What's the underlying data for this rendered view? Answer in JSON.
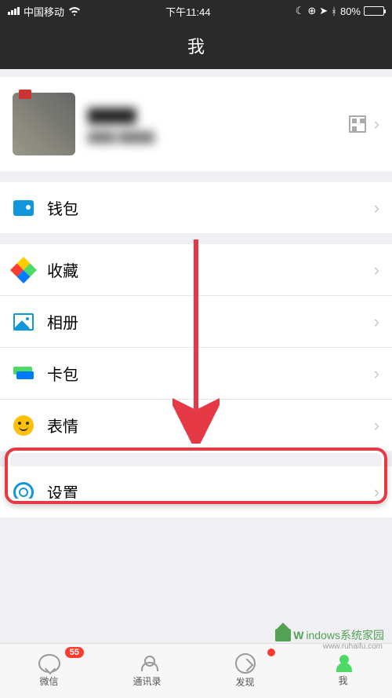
{
  "status": {
    "carrier": "中国移动",
    "time": "下午11:44",
    "battery_pct": "80%"
  },
  "nav": {
    "title": "我"
  },
  "profile": {
    "name_blur": "▇▇▇▇",
    "id_blur": "▇▇▇ ▇▇▇▇"
  },
  "rows": {
    "wallet": "钱包",
    "favorites": "收藏",
    "album": "相册",
    "cards": "卡包",
    "stickers": "表情",
    "settings": "设置"
  },
  "tabs": {
    "wechat": "微信",
    "contacts": "通讯录",
    "discover": "发现",
    "me": "我",
    "badge_count": "55"
  },
  "watermark": {
    "text": "indows系统家园",
    "url": "www.ruhaifu.com"
  },
  "colors": {
    "highlight": "#e63946",
    "bg": "#efeff4"
  }
}
